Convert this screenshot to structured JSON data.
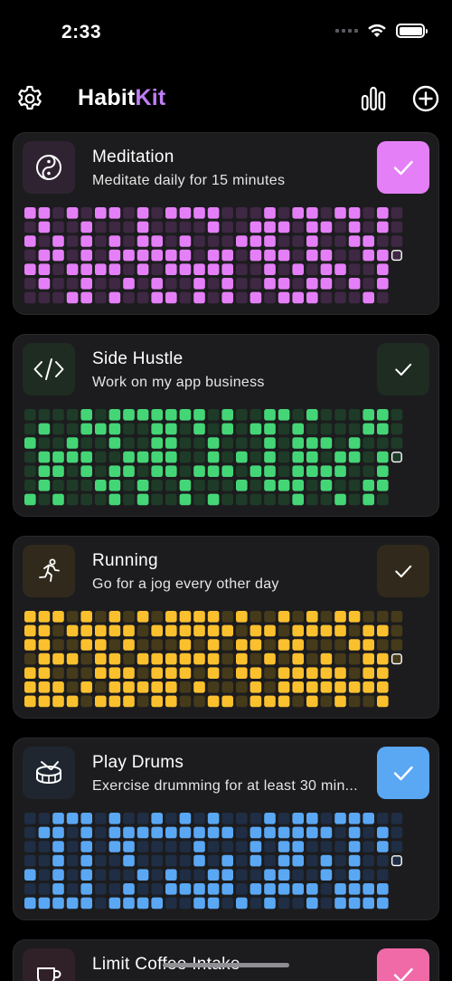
{
  "status_bar": {
    "time": "2:33",
    "icons": [
      "cellular-signal-icon",
      "wifi-icon",
      "battery-icon"
    ]
  },
  "header": {
    "title_part1": "Habit",
    "title_part2": "Kit",
    "title_accent": "#c07ef5",
    "left_icon": "gear-icon",
    "right_icons": [
      "bar-chart-icon",
      "add-circle-icon"
    ]
  },
  "habits": [
    {
      "name": "Meditation",
      "description": "Meditate daily for 15 minutes",
      "icon": "yin-yang-icon",
      "color": "#e57ff8",
      "dim_color": "#3f2844",
      "icon_bg": "#2f2331",
      "check_bg": "#e57ff8",
      "completed_today": true,
      "grid": [
        "11010110101111000101101101",
        "01001000100001001110110101",
        "10101010110100011100100110",
        "01101011111101101110110011",
        "11011110101111100101011001",
        "01001001010010100110110101",
        "00011010011010101011100010"
      ]
    },
    {
      "name": "Side Hustle",
      "description": "Work on my app business",
      "icon": "code-brackets-icon",
      "color": "#44d676",
      "dim_color": "#1e3b28",
      "icon_bg": "#1e2c22",
      "check_bg": "#1e2c22",
      "completed_today": false,
      "grid": [
        "00001011111110100110100011",
        "01001110011010101101000011",
        "10010010011001000101110100",
        "01111001111001010101101101",
        "01101011011011101101111001",
        "01000110100100010111010011",
        "10100010100101000001001010"
      ]
    },
    {
      "name": "Running",
      "description": "Go for a jog every other day",
      "icon": "running-person-icon",
      "color": "#fbc02d",
      "dim_color": "#453a1a",
      "icon_bg": "#312a1c",
      "check_bg": "#312a1c",
      "completed_today": false,
      "grid": [
        "11101010101111010010101100",
        "11011111011111101101111011",
        "11001101000101011011000110",
        "01110110111111010101010011",
        "11000111011101011011111011",
        "11101011111010001011111111",
        "11110111011001101110101001"
      ]
    },
    {
      "name": "Play Drums",
      "description": "Exercise drumming for at least 30 min...",
      "icon": "drum-icon",
      "color": "#5aa7f4",
      "dim_color": "#1f2e44",
      "icon_bg": "#1f2630",
      "check_bg": "#5aa7f4",
      "completed_today": true,
      "grid": [
        "00111010010101000101101110",
        "01101011111111101111110101",
        "00101011000010001011000101",
        "00101001000010101011010100",
        "10101000101001100110010100",
        "00101001001111101111101111",
        "11111011110011010100101111"
      ]
    },
    {
      "name": "Limit Coffee Intake",
      "description": "",
      "icon": "coffee-cup-icon",
      "color": "#f06aa8",
      "dim_color": "#44253a",
      "icon_bg": "#302028",
      "check_bg": "#f06aa8",
      "completed_today": true,
      "grid": []
    }
  ]
}
